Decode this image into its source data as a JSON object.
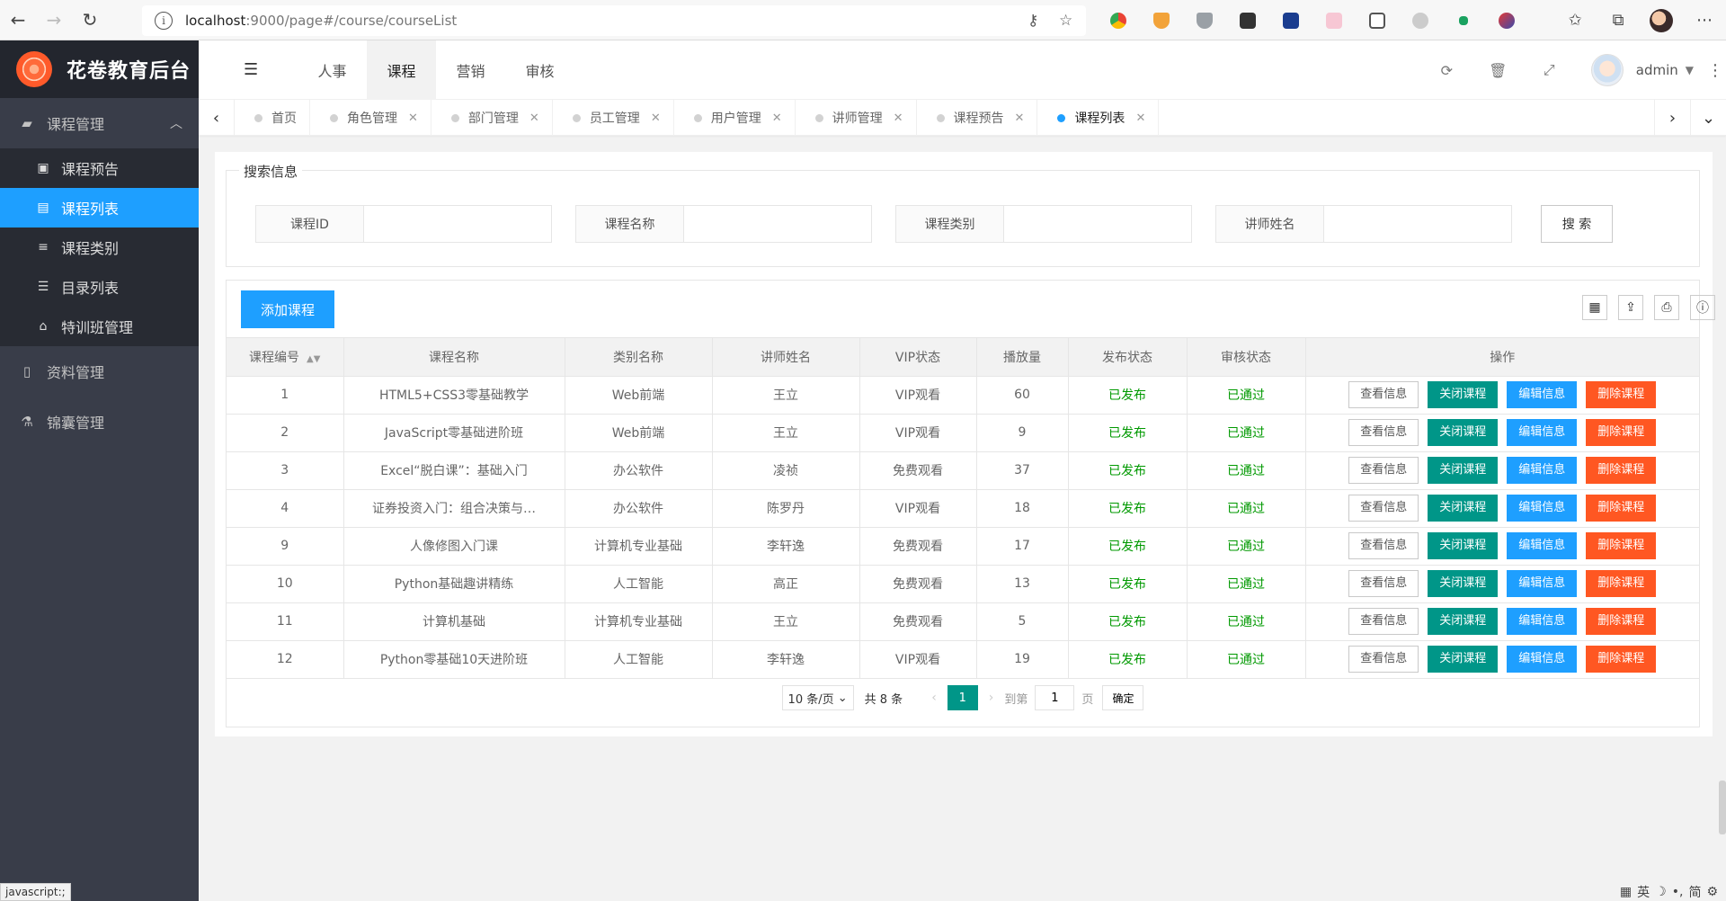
{
  "browser": {
    "url_host": "localhost",
    "url_rest": ":9000/page#/course/courseList"
  },
  "sidebar": {
    "app_title": "花卷教育后台",
    "groups": [
      {
        "label": "课程管理",
        "icon": "book-icon"
      },
      {
        "label": "资料管理",
        "icon": "file-icon"
      },
      {
        "label": "锦囊管理",
        "icon": "flask-icon"
      }
    ],
    "sub_items": [
      {
        "label": "课程预告",
        "icon": "twitch-icon"
      },
      {
        "label": "课程列表",
        "icon": "list-box-icon"
      },
      {
        "label": "课程类别",
        "icon": "bars-icon"
      },
      {
        "label": "目录列表",
        "icon": "sliders-icon"
      },
      {
        "label": "特训班管理",
        "icon": "bank-icon"
      }
    ],
    "status_tip": "javascript:;"
  },
  "header": {
    "nav": [
      "人事",
      "课程",
      "营销",
      "审核"
    ],
    "username": "admin"
  },
  "tabs": [
    {
      "label": "首页"
    },
    {
      "label": "角色管理"
    },
    {
      "label": "部门管理"
    },
    {
      "label": "员工管理"
    },
    {
      "label": "用户管理"
    },
    {
      "label": "讲师管理"
    },
    {
      "label": "课程预告"
    },
    {
      "label": "课程列表"
    }
  ],
  "search": {
    "legend": "搜索信息",
    "fields": [
      "课程ID",
      "课程名称",
      "课程类别",
      "讲师姓名"
    ],
    "button": "搜 索"
  },
  "toolbar": {
    "add_label": "添加课程"
  },
  "table": {
    "headers": [
      "课程编号",
      "课程名称",
      "类别名称",
      "讲师姓名",
      "VIP状态",
      "播放量",
      "发布状态",
      "审核状态",
      "操作"
    ],
    "ops": [
      "查看信息",
      "关闭课程",
      "编辑信息",
      "删除课程"
    ],
    "rows": [
      [
        "1",
        "HTML5+CSS3零基础教学",
        "Web前端",
        "王立",
        "VIP观看",
        "60",
        "已发布",
        "已通过"
      ],
      [
        "2",
        "JavaScript零基础进阶班",
        "Web前端",
        "王立",
        "VIP观看",
        "9",
        "已发布",
        "已通过"
      ],
      [
        "3",
        "Excel“脱白课”：基础入门",
        "办公软件",
        "凌祯",
        "免费观看",
        "37",
        "已发布",
        "已通过"
      ],
      [
        "4",
        "证券投资入门：组合决策与…",
        "办公软件",
        "陈罗丹",
        "VIP观看",
        "18",
        "已发布",
        "已通过"
      ],
      [
        "9",
        "人像修图入门课",
        "计算机专业基础",
        "李轩逸",
        "免费观看",
        "17",
        "已发布",
        "已通过"
      ],
      [
        "10",
        "Python基础趣讲精练",
        "人工智能",
        "高正",
        "免费观看",
        "13",
        "已发布",
        "已通过"
      ],
      [
        "11",
        "计算机基础",
        "计算机专业基础",
        "王立",
        "免费观看",
        "5",
        "已发布",
        "已通过"
      ],
      [
        "12",
        "Python零基础10天进阶班",
        "人工智能",
        "李轩逸",
        "VIP观看",
        "19",
        "已发布",
        "已通过"
      ]
    ]
  },
  "pager": {
    "per_page": "10 条/页",
    "total": "共 8 条",
    "current": "1",
    "goto_label": "到第",
    "goto_value": "1",
    "page_unit": "页",
    "confirm": "确定"
  },
  "ime": [
    "英",
    "简"
  ],
  "colors": {
    "sidebar_bg": "#393d49",
    "sidebar_dark": "#23262e",
    "accent_blue": "#1e9fff",
    "teal": "#009688",
    "orange": "#ff5722",
    "green_text": "#009900"
  }
}
